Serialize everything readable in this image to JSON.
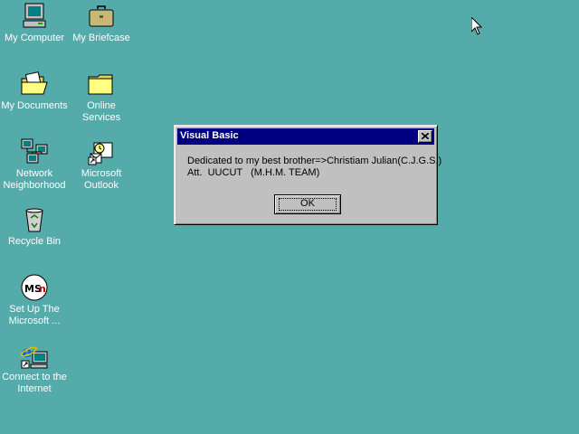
{
  "desktop": {
    "background": "#55aaaa",
    "icons": [
      {
        "label": "My Computer",
        "icon": "computer-icon"
      },
      {
        "label": "My Briefcase",
        "icon": "briefcase-icon"
      },
      {
        "label": "My Documents",
        "icon": "documents-folder-icon"
      },
      {
        "label": "Online\nServices",
        "icon": "folder-icon"
      },
      {
        "label": "Network\nNeighborhood",
        "icon": "network-icon"
      },
      {
        "label": "Microsoft\nOutlook",
        "icon": "outlook-icon"
      },
      {
        "label": "Recycle Bin",
        "icon": "recycle-bin-icon"
      },
      {
        "label": "Set Up The\nMicrosoft ...",
        "icon": "msn-icon"
      },
      {
        "label": "Connect to the\nInternet",
        "icon": "internet-explorer-icon"
      }
    ]
  },
  "dialog": {
    "title": "Visual Basic",
    "message_line1": "Dedicated to my best brother=>Christiam Julian(C.J.G.S.)",
    "message_line2": "Att.  UUCUT   (M.H.M. TEAM)",
    "ok_label": "OK",
    "titlebar_color": "#000080"
  }
}
